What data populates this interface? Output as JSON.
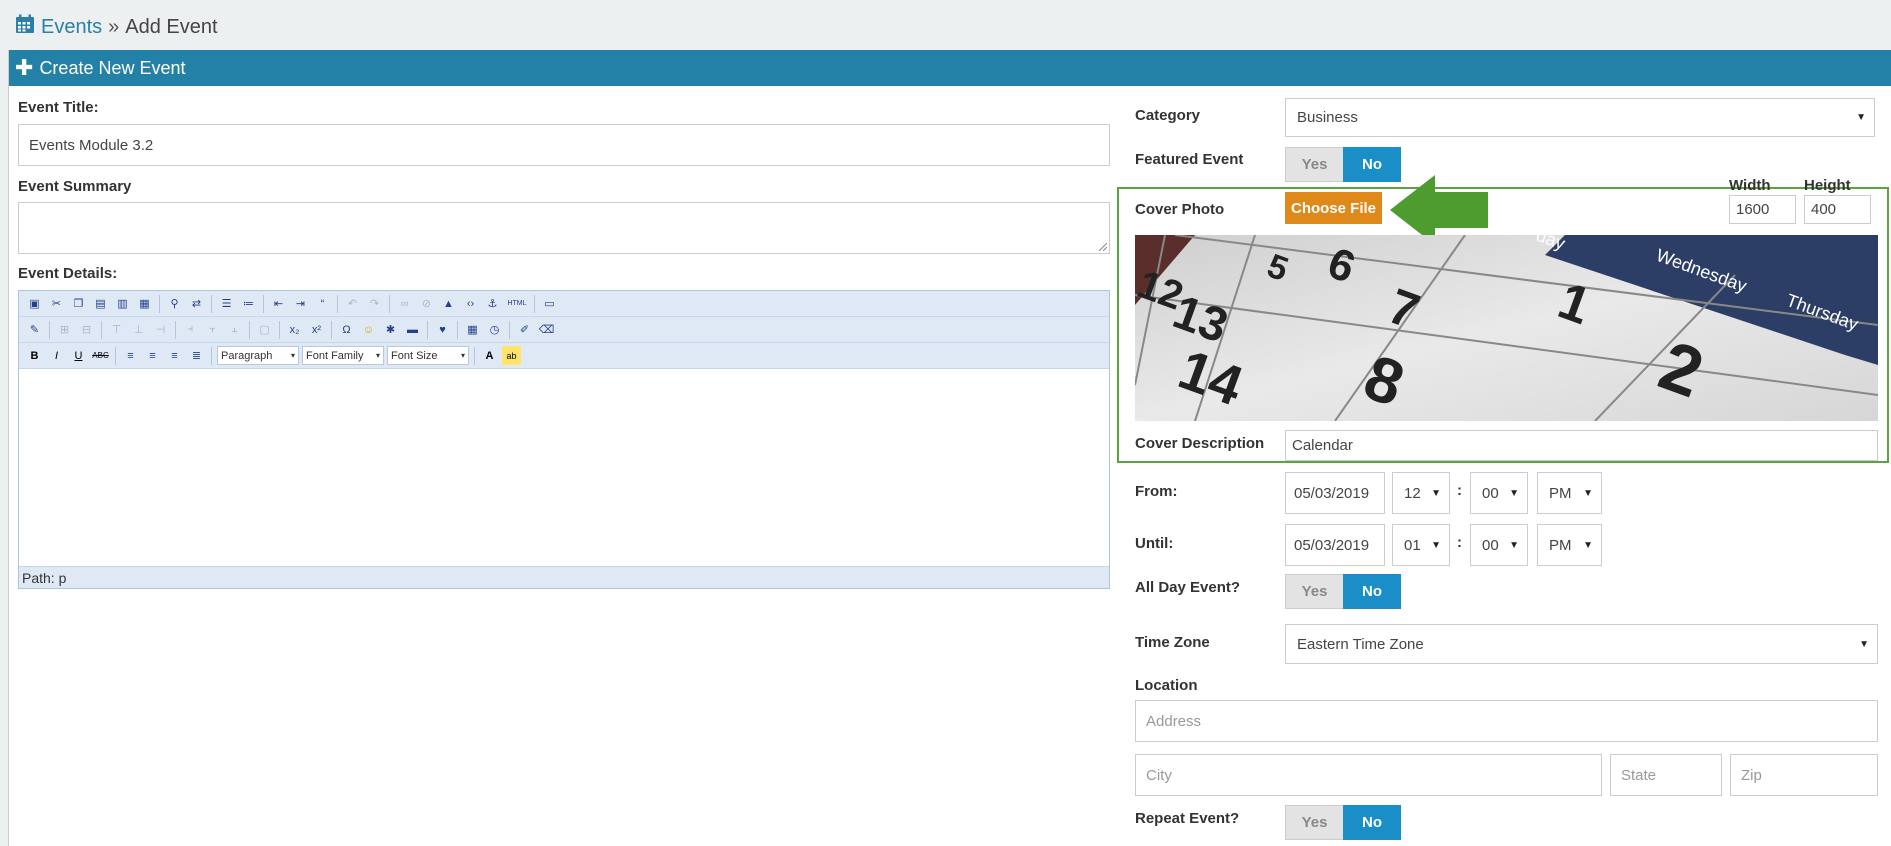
{
  "breadcrumb": {
    "parent": "Events",
    "separator": "»",
    "current": "Add Event"
  },
  "panel": {
    "title": "Create New Event"
  },
  "form": {
    "event_title_label": "Event Title:",
    "event_title_value": "Events Module 3.2",
    "event_summary_label": "Event Summary",
    "event_summary_value": "",
    "event_details_label": "Event Details:",
    "editor": {
      "format_dropdown": "Paragraph",
      "font_family_dropdown": "Font Family",
      "font_size_dropdown": "Font Size",
      "status_path": "Path: p"
    },
    "category_label": "Category",
    "category_value": "Business",
    "featured_label": "Featured Event",
    "yes_label": "Yes",
    "no_label": "No",
    "cover_photo_label": "Cover Photo",
    "choose_file_label": "Choose File",
    "width_label": "Width",
    "height_label": "Height",
    "width_value": "1600",
    "height_value": "400",
    "cover_description_label": "Cover Description",
    "cover_description_value": "Calendar",
    "from_label": "From:",
    "until_label": "Until:",
    "from": {
      "date": "05/03/2019",
      "hour": "12",
      "minute": "00",
      "ampm": "PM"
    },
    "until": {
      "date": "05/03/2019",
      "hour": "01",
      "minute": "00",
      "ampm": "PM"
    },
    "time_colon": ":",
    "all_day_label": "All Day Event?",
    "time_zone_label": "Time Zone",
    "time_zone_value": "Eastern Time Zone",
    "location_label": "Location",
    "address_placeholder": "Address",
    "city_placeholder": "City",
    "state_placeholder": "State",
    "zip_placeholder": "Zip",
    "repeat_label": "Repeat Event?"
  },
  "cover_image": {
    "subject": "calendar",
    "numbers": [
      "5",
      "6",
      "7",
      "12",
      "13",
      "14",
      "8",
      "1",
      "2"
    ],
    "day_headers": [
      "Wednesday",
      "Thursday",
      "day"
    ]
  },
  "colors": {
    "header_blue": "#2381a8",
    "toggle_active": "#1a8ec6",
    "choose_file_orange": "#e0891b",
    "highlight_green": "#5aa33f",
    "arrow_green": "#4e9b2f"
  }
}
